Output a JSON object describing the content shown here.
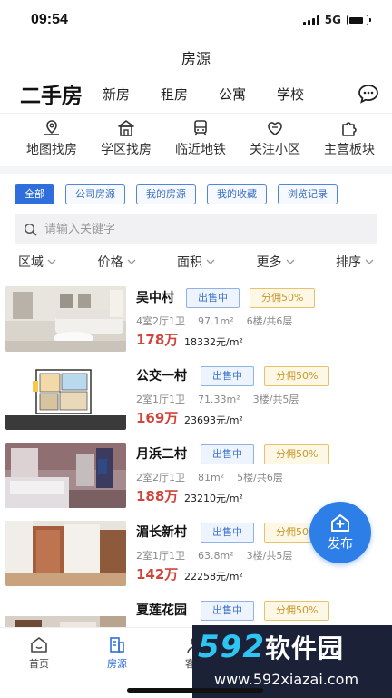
{
  "status_bar": {
    "time": "09:54",
    "network": "5G"
  },
  "header": {
    "title": "房源"
  },
  "type_tabs": {
    "active": "二手房",
    "items": [
      "新房",
      "租房",
      "公寓",
      "学校"
    ]
  },
  "quick_links": [
    {
      "label": "地图找房",
      "icon": "map-pin-icon"
    },
    {
      "label": "学区找房",
      "icon": "school-icon"
    },
    {
      "label": "临近地铁",
      "icon": "subway-icon"
    },
    {
      "label": "关注小区",
      "icon": "heart-building-icon"
    },
    {
      "label": "主营板块",
      "icon": "puzzle-icon"
    }
  ],
  "filter_chips": [
    "全部",
    "公司房源",
    "我的房源",
    "我的收藏",
    "浏览记录"
  ],
  "search": {
    "placeholder": "请输入关键字"
  },
  "sort_bar": [
    "区域",
    "价格",
    "面积",
    "更多",
    "排序"
  ],
  "listings": [
    {
      "title": "吴中村",
      "status": "出售中",
      "commission": "分佣50%",
      "layout": "4室2厅1卫",
      "area": "97.1m²",
      "floor": "6楼/共6层",
      "price": "178万",
      "unit_price": "18332元/m²"
    },
    {
      "title": "公交一村",
      "status": "出售中",
      "commission": "分佣50%",
      "layout": "2室1厅1卫",
      "area": "71.33m²",
      "floor": "3楼/共5层",
      "price": "169万",
      "unit_price": "23693元/m²"
    },
    {
      "title": "月浜二村",
      "status": "出售中",
      "commission": "分佣50%",
      "layout": "2室2厅1卫",
      "area": "81m²",
      "floor": "5楼/共6层",
      "price": "188万",
      "unit_price": "23210元/m²"
    },
    {
      "title": "湄长新村",
      "status": "出售中",
      "commission": "分佣50%",
      "layout": "2室1厅1卫",
      "area": "63.8m²",
      "floor": "3楼/共5层",
      "price": "142万",
      "unit_price": "22258元/m²"
    },
    {
      "title": "夏莲花园",
      "status": "出售中",
      "commission": "分佣50%"
    }
  ],
  "fab": {
    "label": "发布"
  },
  "bottom_nav": [
    {
      "label": "首页",
      "icon": "home-icon"
    },
    {
      "label": "房源",
      "icon": "building-icon"
    },
    {
      "label": "客源",
      "icon": "person-icon"
    }
  ],
  "watermark": {
    "brand_digits": "592",
    "brand_text": "软件园",
    "url": "www.592xiazai.com"
  },
  "colors": {
    "accent": "#2f6fdb",
    "price": "#d0443b",
    "commission": "#c89a2c",
    "fab": "#2e7ee8"
  }
}
